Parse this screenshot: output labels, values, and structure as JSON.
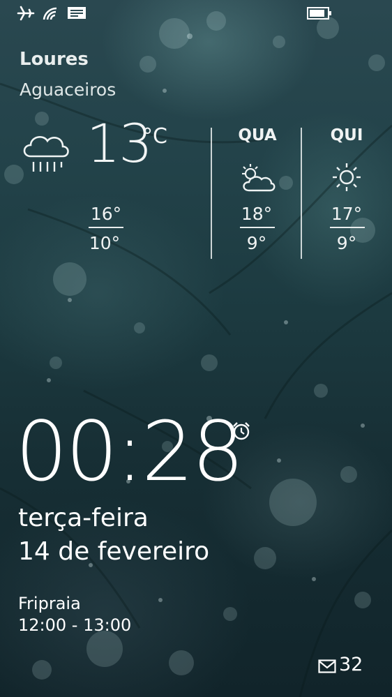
{
  "status_bar": {
    "icons": [
      "airplane-icon",
      "wifi-icon",
      "messaging-icon",
      "battery-icon"
    ],
    "battery_level": 0.85
  },
  "weather": {
    "location": "Loures",
    "condition": "Aguaceiros",
    "current": {
      "icon": "rain-cloud-icon",
      "temp": "13",
      "unit": "°C",
      "high": "16°",
      "low": "10°"
    },
    "forecast": [
      {
        "day": "QUA",
        "icon": "partly-cloudy-icon",
        "high": "18°",
        "low": "9°"
      },
      {
        "day": "QUI",
        "icon": "sun-icon",
        "high": "17°",
        "low": "9°"
      }
    ]
  },
  "clock": {
    "time": "00:28",
    "alarm_icon": "alarm-clock-icon",
    "weekday": "terça-feira",
    "date": "14 de fevereiro"
  },
  "event": {
    "title": "Fripraia",
    "time": "12:00 - 13:00"
  },
  "notifications": {
    "mail_icon": "mail-icon",
    "mail_count": "32"
  }
}
